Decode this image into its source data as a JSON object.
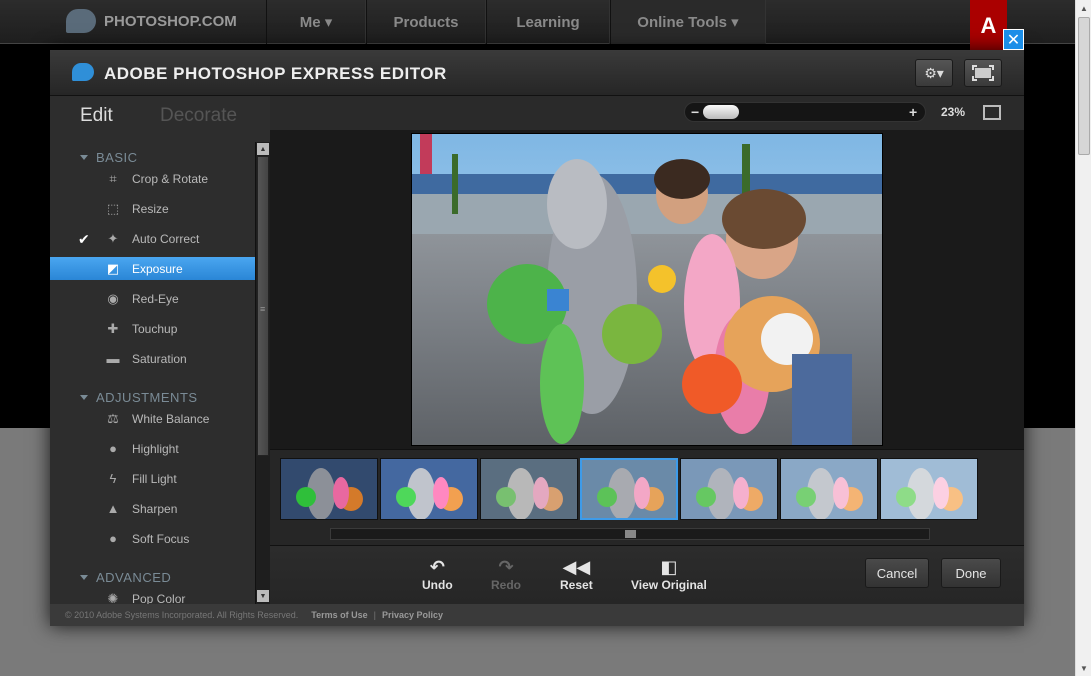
{
  "site": {
    "logo_text": "PHOTOSHOP.COM",
    "nav": [
      {
        "label": "Me ▾"
      },
      {
        "label": "Products"
      },
      {
        "label": "Learning"
      },
      {
        "label": "Online Tools ▾"
      }
    ],
    "adobe_label": "A"
  },
  "editor": {
    "title": "ADOBE PHOTOSHOP EXPRESS EDITOR",
    "settings_icon": "gear-icon",
    "fullscreen_icon": "fullscreen-icon",
    "close_glyph": "✕"
  },
  "left_panel": {
    "tabs": {
      "edit": "Edit",
      "decorate": "Decorate"
    },
    "sections": {
      "basic": "BASIC",
      "adjustments": "ADJUSTMENTS",
      "advanced": "ADVANCED"
    },
    "basic_tools": [
      {
        "label": "Crop & Rotate",
        "icon": "crop-icon"
      },
      {
        "label": "Resize",
        "icon": "resize-icon"
      },
      {
        "label": "Auto Correct",
        "icon": "magic-wand-icon",
        "checked": true
      },
      {
        "label": "Exposure",
        "icon": "exposure-icon",
        "active": true
      },
      {
        "label": "Red-Eye",
        "icon": "eye-icon"
      },
      {
        "label": "Touchup",
        "icon": "bandage-icon"
      },
      {
        "label": "Saturation",
        "icon": "saturation-icon"
      }
    ],
    "adjustment_tools": [
      {
        "label": "White Balance",
        "icon": "scale-icon"
      },
      {
        "label": "Highlight",
        "icon": "bulb-icon"
      },
      {
        "label": "Fill Light",
        "icon": "lightning-icon"
      },
      {
        "label": "Sharpen",
        "icon": "triangle-icon"
      },
      {
        "label": "Soft Focus",
        "icon": "drop-icon"
      }
    ],
    "advanced_tools": [
      {
        "label": "Pop Color",
        "icon": "pop-color-icon"
      }
    ]
  },
  "zoom": {
    "minus": "−",
    "plus": "+",
    "percent": "23%",
    "level": 0.23
  },
  "filmstrip": {
    "count": 7,
    "selected_index": 3
  },
  "actions": {
    "undo": "Undo",
    "redo": "Redo",
    "reset": "Reset",
    "view_original": "View Original",
    "cancel": "Cancel",
    "done": "Done"
  },
  "footer": {
    "copyright": "© 2010 Adobe Systems Incorporated. All Rights Reserved.",
    "terms": "Terms of Use",
    "separator": "|",
    "privacy": "Privacy Policy"
  }
}
